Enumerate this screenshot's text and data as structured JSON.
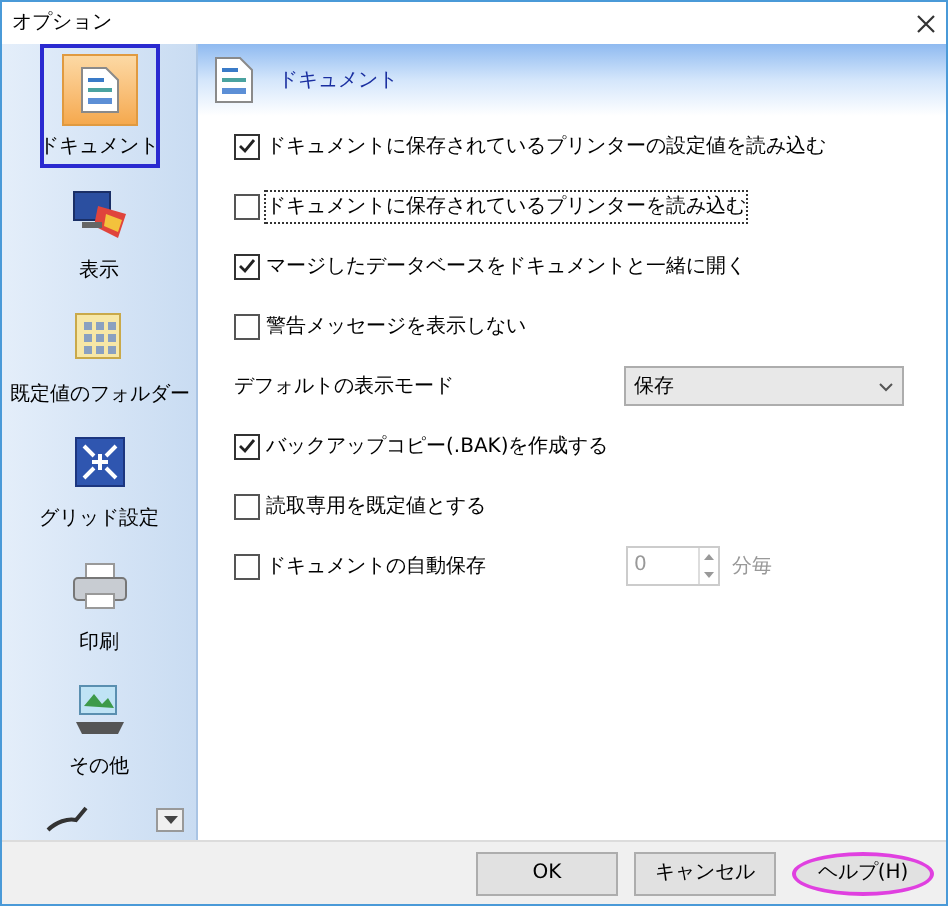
{
  "window": {
    "title": "オプション"
  },
  "sidebar": {
    "items": [
      {
        "label": "ドキュメント",
        "selected": true
      },
      {
        "label": "表示",
        "selected": false
      },
      {
        "label": "既定値のフォルダー",
        "selected": false
      },
      {
        "label": "グリッド設定",
        "selected": false
      },
      {
        "label": "印刷",
        "selected": false
      },
      {
        "label": "その他",
        "selected": false
      }
    ]
  },
  "header": {
    "title": "ドキュメント"
  },
  "options": [
    {
      "kind": "checkbox",
      "label": "ドキュメントに保存されているプリンターの設定値を読み込む",
      "checked": true,
      "focused": false
    },
    {
      "kind": "checkbox",
      "label": "ドキュメントに保存されているプリンターを読み込む",
      "checked": false,
      "focused": true
    },
    {
      "kind": "checkbox",
      "label": "マージしたデータベースをドキュメントと一緒に開く",
      "checked": true,
      "focused": false
    },
    {
      "kind": "checkbox",
      "label": "警告メッセージを表示しない",
      "checked": false,
      "focused": false
    },
    {
      "kind": "select",
      "label": "デフォルトの表示モード",
      "value": "保存"
    },
    {
      "kind": "checkbox",
      "label": "バックアップコピー(.BAK)を作成する",
      "checked": true,
      "focused": false
    },
    {
      "kind": "checkbox",
      "label": "読取専用を既定値とする",
      "checked": false,
      "focused": false
    },
    {
      "kind": "spin",
      "label": "ドキュメントの自動保存",
      "checked": false,
      "value": "0",
      "unit": "分毎",
      "disabled": true
    }
  ],
  "buttons": [
    {
      "label": "OK",
      "highlighted": false
    },
    {
      "label": "キャンセル",
      "highlighted": false
    },
    {
      "label": "ヘルプ(H)",
      "highlighted": true
    }
  ]
}
